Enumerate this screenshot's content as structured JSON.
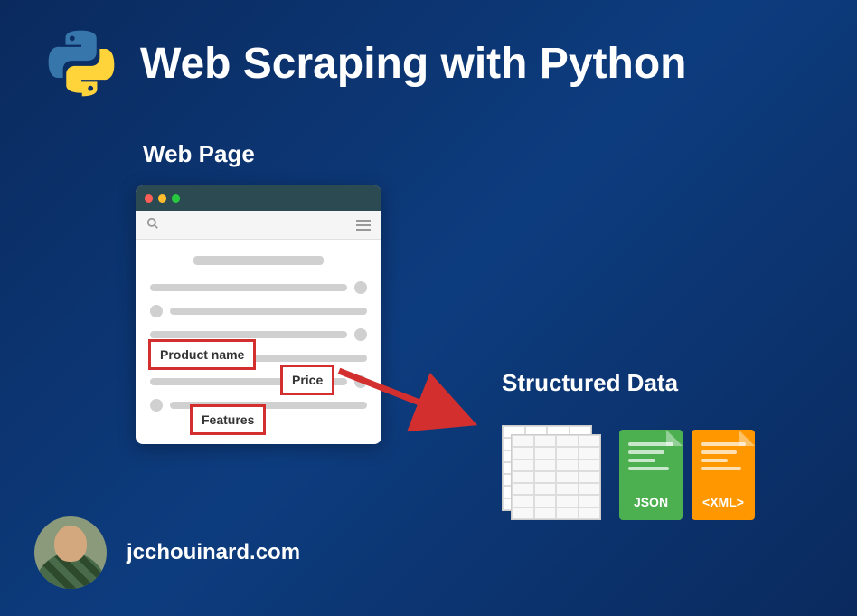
{
  "title": "Web Scraping with Python",
  "webpage_label": "Web Page",
  "structured_label": "Structured Data",
  "highlights": {
    "product": "Product name",
    "price": "Price",
    "features": "Features"
  },
  "files": {
    "json": "JSON",
    "xml": "<XML>"
  },
  "footer": {
    "site": "jcchouinard.com"
  }
}
